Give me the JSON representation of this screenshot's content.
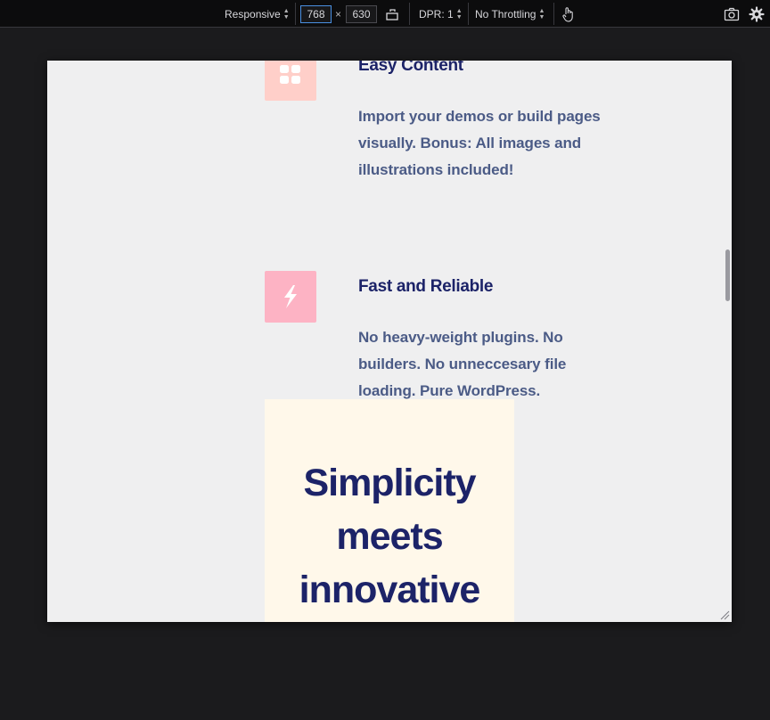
{
  "toolbar": {
    "device_label": "Responsive",
    "width_value": "768",
    "times": "×",
    "height_value": "630",
    "dpr_label": "DPR: 1",
    "throttle_label": "No Throttling"
  },
  "features": [
    {
      "title": "Easy Content",
      "text": "Import your demos or build pages visually. Bonus: All images and illustrations included!",
      "icon": "grid-icon",
      "icon_bg": "#ffcfc9"
    },
    {
      "title": "Fast and Reliable",
      "text": "No heavy-weight plugins. No builders. No unneccesary file loading. Pure WordPress.",
      "icon": "lightning-icon",
      "icon_bg": "#fdb3c4"
    }
  ],
  "hero": {
    "title": "Simplicity meets innovative"
  },
  "colors": {
    "heading": "#1c2368",
    "body_text": "#4b5b86",
    "viewport_bg": "#efeff0",
    "hero_bg": "#fff8ea",
    "devtools_bg": "#0c0c0d"
  }
}
